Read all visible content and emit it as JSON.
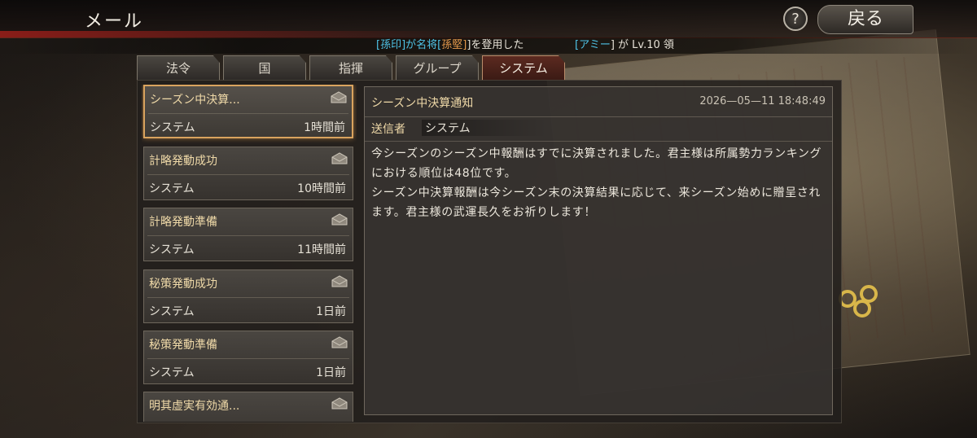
{
  "header": {
    "title": "メール",
    "help_label": "?",
    "back_label": "戻る"
  },
  "ticker": {
    "part1_open": "[",
    "part1_name": "孫印",
    "part1_mid": "]が名将[",
    "part1_general": "孫堅",
    "part1_end": "]を登用した",
    "part2_open": "[",
    "part2_name": "アミー",
    "part2_end": "] が Lv.10 領"
  },
  "tabs": [
    {
      "label": "法令",
      "active": false
    },
    {
      "label": "国",
      "active": false
    },
    {
      "label": "指揮",
      "active": false
    },
    {
      "label": "グループ",
      "active": false
    },
    {
      "label": "システム",
      "active": true
    }
  ],
  "mails": [
    {
      "subject": "シーズン中決算...",
      "sender": "システム",
      "time": "1時間前",
      "selected": true
    },
    {
      "subject": "計略発動成功",
      "sender": "システム",
      "time": "10時間前",
      "selected": false
    },
    {
      "subject": "計略発動準備",
      "sender": "システム",
      "time": "11時間前",
      "selected": false
    },
    {
      "subject": "秘策発動成功",
      "sender": "システム",
      "time": "1日前",
      "selected": false
    },
    {
      "subject": "秘策発動準備",
      "sender": "システム",
      "time": "1日前",
      "selected": false
    },
    {
      "subject": "明其虚実有効通...",
      "sender": "",
      "time": "",
      "selected": false
    }
  ],
  "detail": {
    "title": "シーズン中決算通知",
    "date": "2026—05—11 18:48:49",
    "sender_label": "送信者",
    "sender_value": "システム",
    "body_p1": "今シーズンのシーズン中報酬はすでに決算されました。君主様は所属勢力ランキングにおける順位は48位です。",
    "body_p2": "シーズン中決算報酬は今シーズン末の決算結果に応じて、来シーズン始めに贈呈されます。君主様の武運長久をお祈りします！"
  },
  "colors": {
    "accent_gold": "#efd9a8",
    "selected_border": "#d9a35e",
    "active_tab": "#5c2a20",
    "ticker_cyan": "#4fc3e6",
    "ticker_orange": "#e59a4c"
  }
}
